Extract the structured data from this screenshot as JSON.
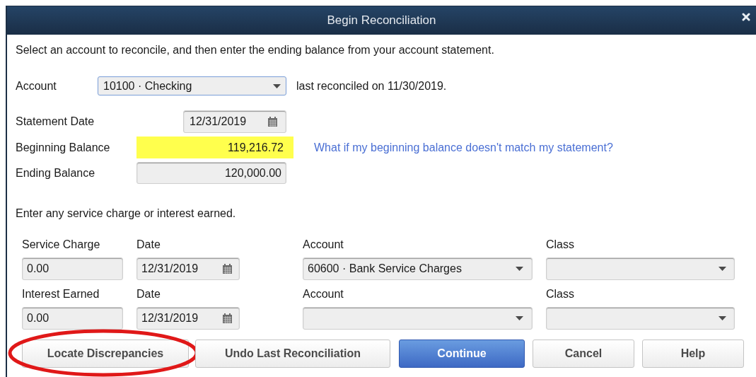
{
  "window": {
    "title": "Begin Reconciliation"
  },
  "instructions": "Select an account to reconcile, and then enter the ending balance from your account statement.",
  "account": {
    "label": "Account",
    "value": "10100 · Checking",
    "focused": true,
    "note": "last reconciled on 11/30/2019."
  },
  "statement_date": {
    "label": "Statement Date",
    "value": "12/31/2019"
  },
  "beginning_balance": {
    "label": "Beginning Balance",
    "value": "119,216.72",
    "highlighted": true
  },
  "help_link": "What if my beginning balance doesn't match my statement?",
  "ending_balance": {
    "label": "Ending Balance",
    "value": "120,000.00",
    "highlighted": false
  },
  "charges_prompt": "Enter any service charge or interest earned.",
  "charge_rows": [
    {
      "amount_label": "Service Charge",
      "amount": "0.00",
      "date_label": "Date",
      "date": "12/31/2019",
      "account_label": "Account",
      "account": "60600 · Bank Service Charges",
      "class_label": "Class"
    },
    {
      "amount_label": "Interest Earned",
      "amount": "0.00",
      "date_label": "Date",
      "date": "12/31/2019",
      "account_label": "Account",
      "class_label": "Class"
    }
  ],
  "buttons": [
    {
      "label": "Locate Discrepancies",
      "default": false,
      "circled": true
    },
    {
      "label": "Undo Last Reconciliation",
      "default": false,
      "circled": false
    },
    {
      "label": "Continue",
      "default": true,
      "circled": false
    },
    {
      "label": "Cancel",
      "default": false,
      "circled": false
    },
    {
      "label": "Help",
      "default": false,
      "circled": false
    }
  ]
}
